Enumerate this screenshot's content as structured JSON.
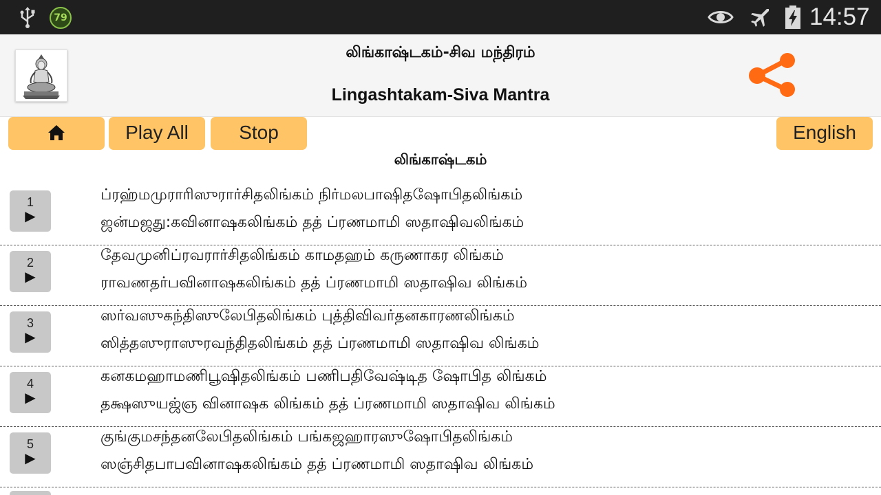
{
  "status_bar": {
    "notification_count": "79",
    "time": "14:57",
    "icons": [
      "usb-icon",
      "notification-79-icon",
      "eye-icon",
      "airplane-mode-icon",
      "battery-charging-icon"
    ]
  },
  "header": {
    "title_tamil": "லிங்காஷ்டகம்-சிவ மந்திரம்",
    "title_english": "Lingashtakam-Siva Mantra",
    "avatar_icon": "shiva-image",
    "share_icon": "share-icon",
    "share_color": "#ff6a13"
  },
  "toolbar": {
    "home_icon": "home-icon",
    "play_all_label": "Play All",
    "stop_label": "Stop",
    "language_label": "English",
    "button_color": "#fec466"
  },
  "section_title": "லிங்காஷ்டகம்",
  "verses": [
    {
      "number": "1",
      "play_glyph": "▶",
      "line1": "ப்ரஹ்மமுராரிஸுரார்சிதலிங்கம் நிர்மலபாஷிதஷோபிதலிங்கம்",
      "line2": "ஜன்மஜது:கவினாஷகலிங்கம் தத் ப்ரணமாமி ஸதாஷிவலிங்கம்"
    },
    {
      "number": "2",
      "play_glyph": "▶",
      "line1": "தேவமுனிப்ரவரார்சிதலிங்கம் காமதஹம் கருணாகர லிங்கம்",
      "line2": "ராவணதர்பவினாஷகலிங்கம் தத் ப்ரணமாமி ஸதாஷிவ லிங்கம்"
    },
    {
      "number": "3",
      "play_glyph": "▶",
      "line1": "ஸர்வஸுகந்திஸுலேபிதலிங்கம் புத்திவிவர்தனகாரணலிங்கம்",
      "line2": "ஸித்தஸுராஸுரவந்திதலிங்கம் தத் ப்ரணமாமி ஸதாஷிவ லிங்கம்"
    },
    {
      "number": "4",
      "play_glyph": "▶",
      "line1": "கனகமஹாமணிபூஷிதலிங்கம் பணிபதிவேஷ்டித ஷோபித லிங்கம்",
      "line2": "தக்ஷஸுயஜ்ஞ வினாஷக லிங்கம் தத் ப்ரணமாமி ஸதாஷிவ லிங்கம்"
    },
    {
      "number": "5",
      "play_glyph": "▶",
      "line1": "குங்குமசந்தனலேபிதலிங்கம் பங்கஜஹாரஸுஷோபிதலிங்கம்",
      "line2": "ஸஞ்சிதபாபவினாஷகலிங்கம் தத் ப்ரணமாமி ஸதாஷிவ லிங்கம்"
    }
  ]
}
